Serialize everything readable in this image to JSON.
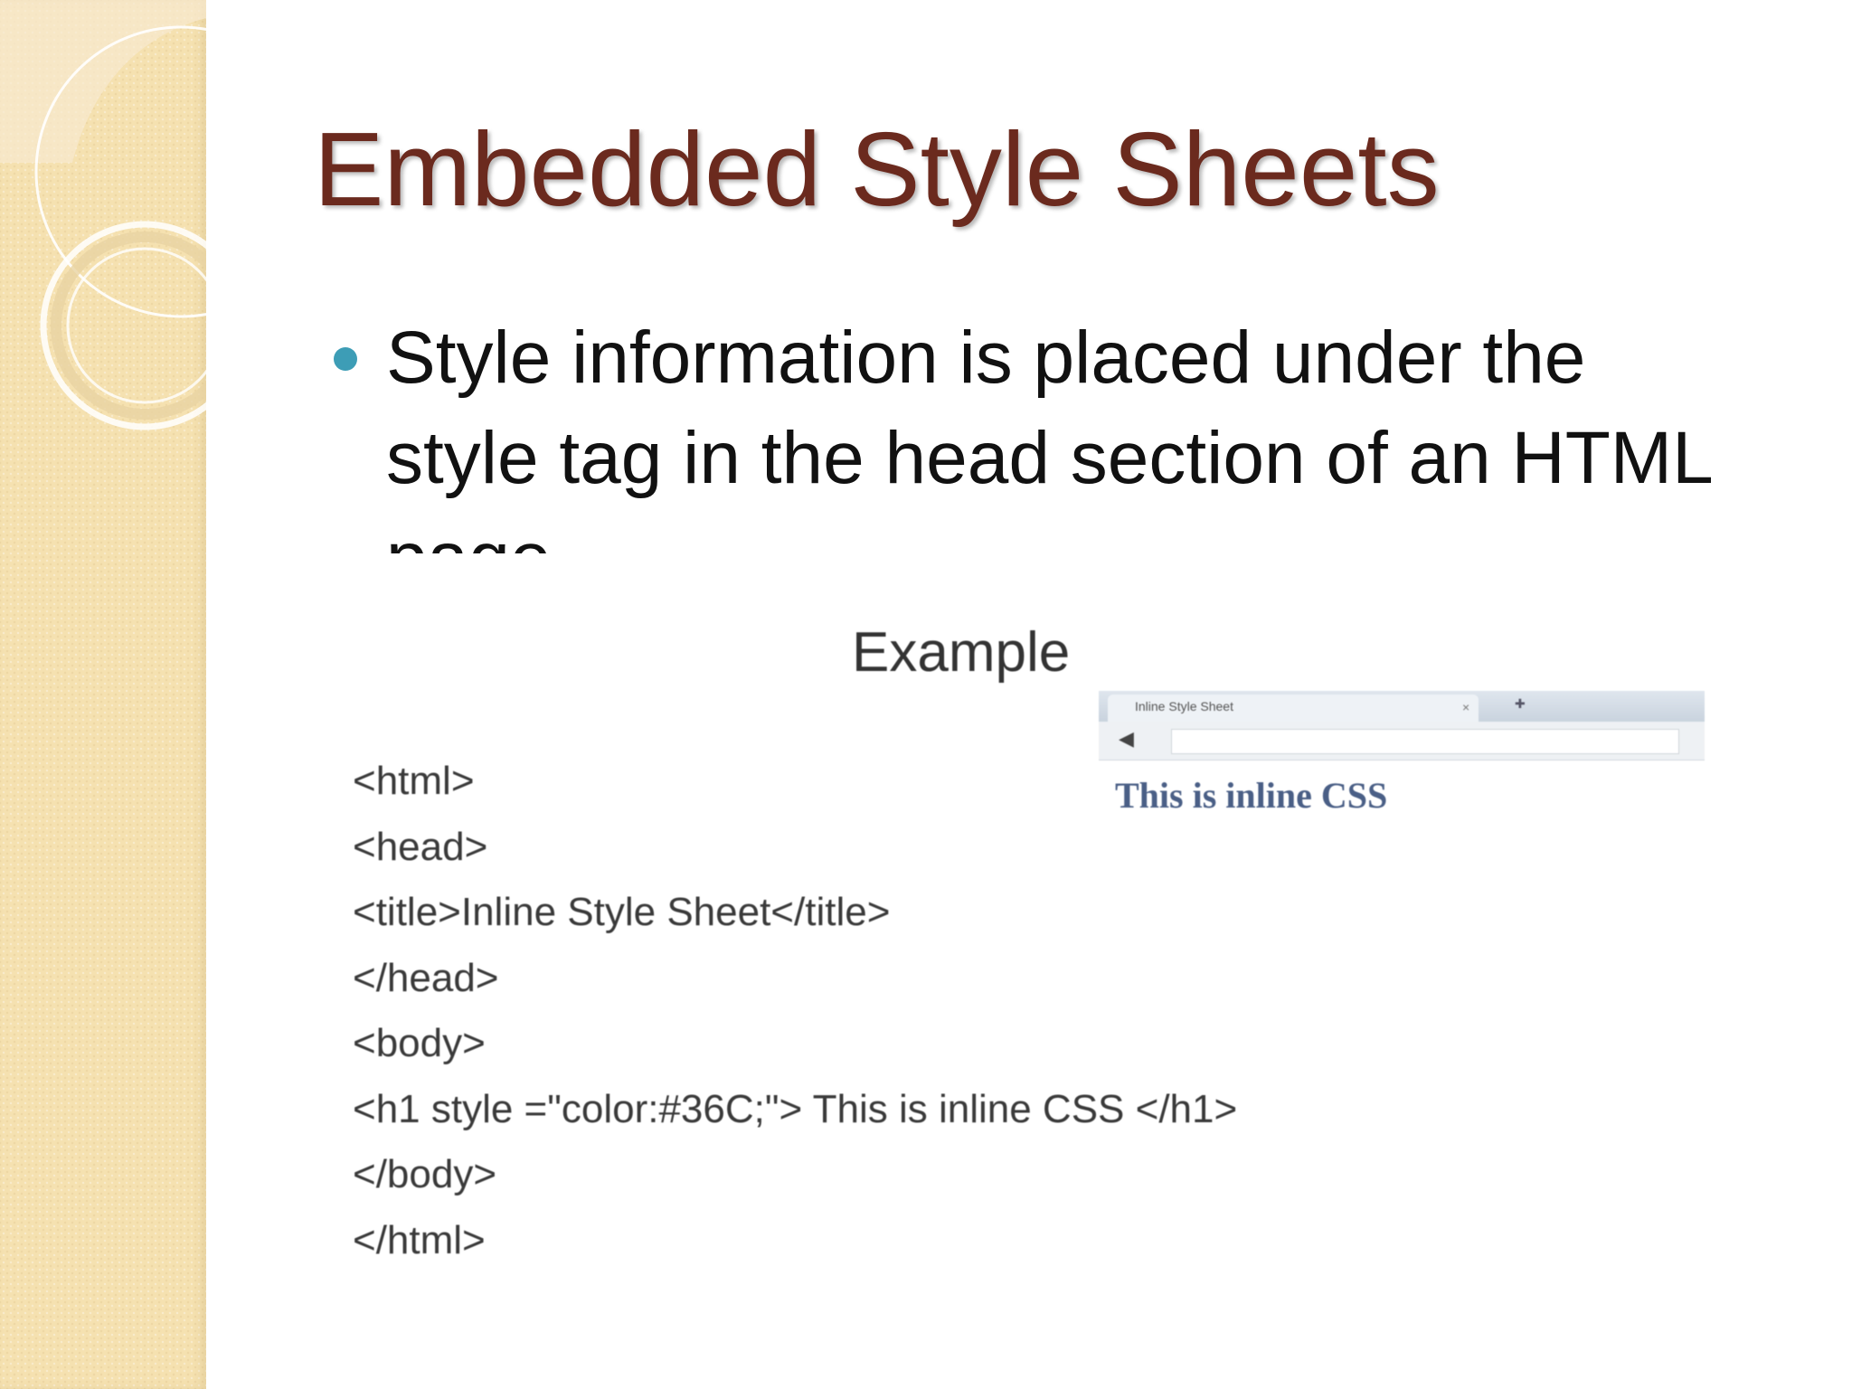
{
  "slide": {
    "title": "Embedded Style Sheets",
    "bullet": "Style information is placed under the style tag in the head section of an HTML page"
  },
  "example_image": {
    "heading": "Example",
    "code_lines": [
      "<html>",
      "<head>",
      "<title>Inline Style Sheet</title>",
      "</head>",
      "<body>",
      "<h1 style =\"color:#36C;\"> This is inline CSS </h1>",
      "</body>",
      "</html>"
    ],
    "browser": {
      "tab_title": "Inline Style Sheet",
      "address": "",
      "rendered_heading": "This is inline CSS"
    }
  },
  "colors": {
    "title": "#6b2a1e",
    "bullet_dot": "#3d9db6",
    "side_strip": "#f5e1b0",
    "rendered_heading": "#4a5f86"
  }
}
